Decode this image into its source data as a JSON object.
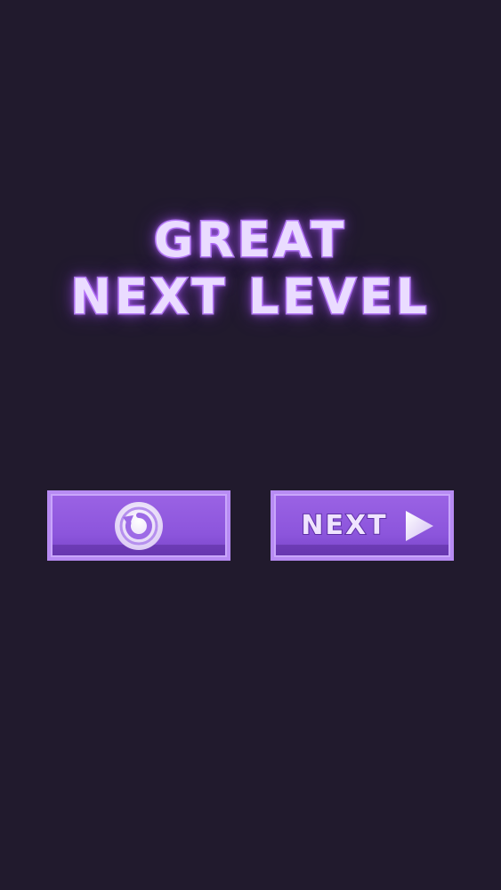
{
  "title": {
    "line1": "GREAT",
    "line2": "NEXT LEVEL"
  },
  "buttons": {
    "restart_icon": "restart-icon",
    "next_label": "NEXT",
    "next_icon": "play-icon"
  },
  "colors": {
    "background": "#211a2d",
    "accent": "#b78bf3",
    "button_fill": "#8c55dc",
    "title_glow": "#b88cf2"
  }
}
